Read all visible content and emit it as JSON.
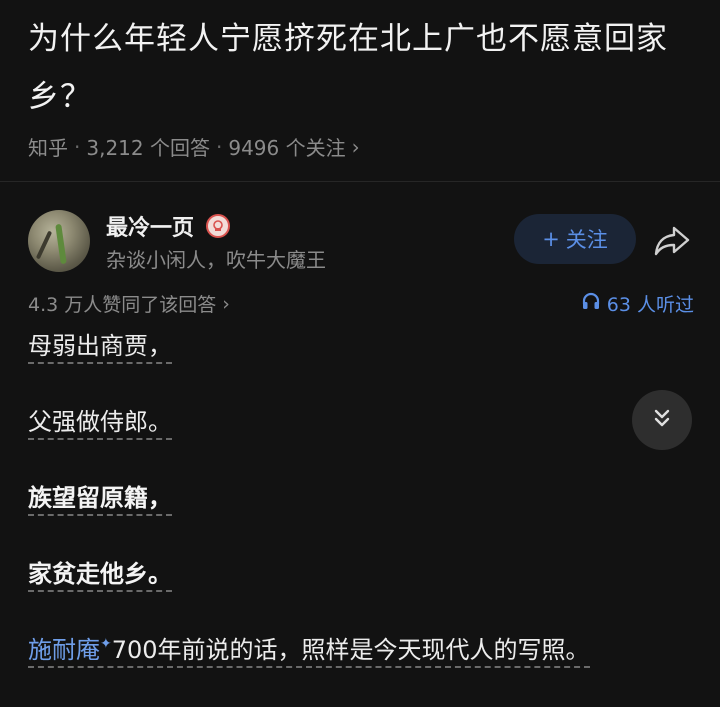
{
  "question": {
    "title": "为什么年轻人宁愿挤死在北上广也不愿意回家乡？",
    "source": "知乎",
    "answers": "3,212 个回答",
    "followers": "9496 个关注",
    "chevron": "›"
  },
  "author": {
    "name": "最冷一页",
    "bio": "杂谈小闲人，吹牛大魔王",
    "badge_icon": "badge-icon"
  },
  "follow_button": {
    "plus": "+",
    "label": "关注"
  },
  "stats": {
    "likes": "4.3 万人赞同了该回答",
    "likes_chevron": "›",
    "listen": "63 人听过"
  },
  "content": {
    "line1": "母弱出商贾，",
    "line2": "父强做侍郎。",
    "line3": "族望留原籍，",
    "line4": "家贫走他乡。",
    "link_text": "施耐庵",
    "sparkle": "✦",
    "line5_rest": "700年前说的话，照样是今天现代人的写照。"
  },
  "colors": {
    "accent": "#5b8fe6",
    "background": "#121212",
    "muted_text": "#8b8b8b"
  }
}
